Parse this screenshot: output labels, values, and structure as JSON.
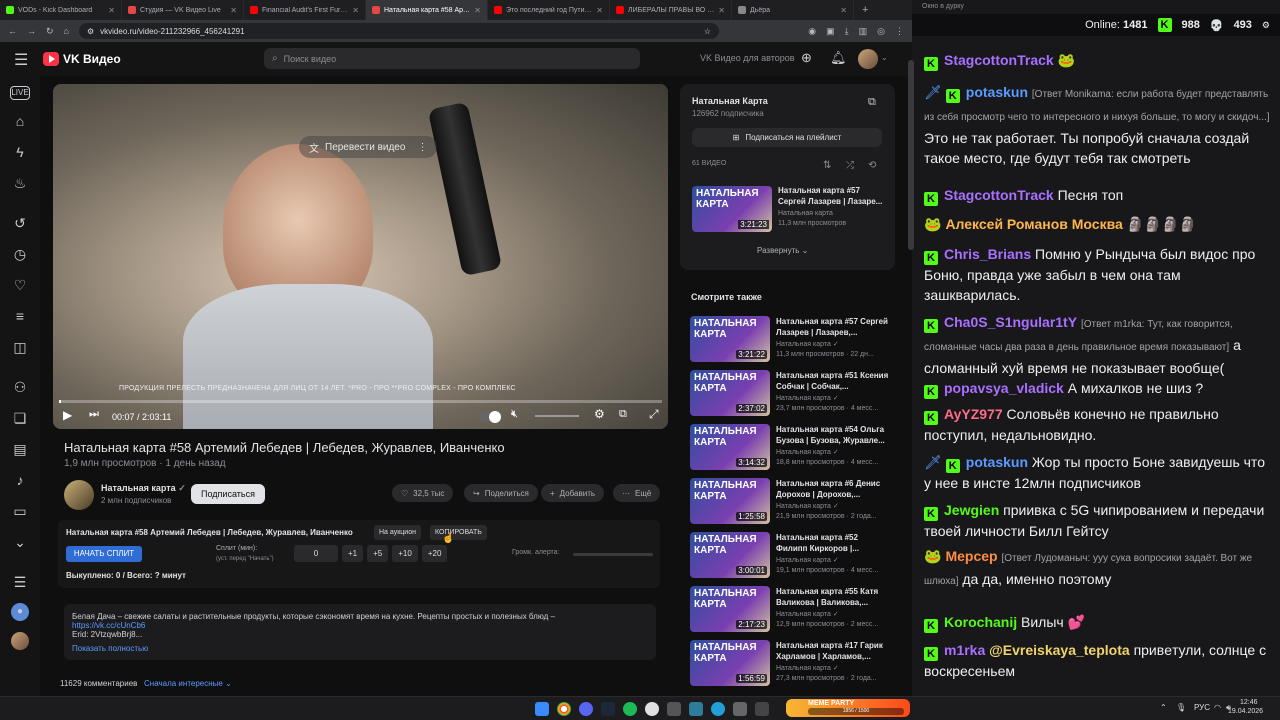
{
  "browser": {
    "tabs": [
      {
        "title": "VODs - Kick Dashboard",
        "color": "#53fc18",
        "active": false
      },
      {
        "title": "Студия — VK Видео Live",
        "color": "#e64646",
        "active": false
      },
      {
        "title": "Financial Audit's First Furry ...",
        "color": "#ff0000",
        "active": false
      },
      {
        "title": "Натальная карта #58 Артем...",
        "color": "#e64646",
        "active": true
      },
      {
        "title": "Это последний год Путина...",
        "color": "#ff0000",
        "active": false
      },
      {
        "title": "ЛИБЕРАЛЫ ПРАВЫ ВО ВСЕМ...",
        "color": "#ff0000",
        "active": false
      },
      {
        "title": "Дьёра",
        "color": "#888888",
        "active": false
      }
    ],
    "url": "vkvideo.ru/video-211232966_456241291"
  },
  "vk": {
    "logo_text": "VK Видео",
    "search_placeholder": "Поиск видео",
    "authors_link": "VK Видео для авторов"
  },
  "player": {
    "translate_label": "Перевести видео",
    "disclaimer": "ПРОДУКЦИЯ ПРЕЛЕСТЬ ПРЕДНАЗНАЧЕНА ДЛЯ ЛИЦ ОТ 14 ЛЕТ. *PRO - ПРО **PRO COMPLEX - ПРО КОМПЛЕКС",
    "time": "00:07 / 2:03:11",
    "progress": 0.001
  },
  "video": {
    "title": "Натальная карта #58 Артемий Лебедев | Лебедев, Журавлев, Иванченко",
    "stats": "1,9 млн просмотров · 1 день назад",
    "channel_name": "Натальная карта",
    "subscribers": "2 млн подписчиков",
    "subscribe": "Подписаться",
    "likes": "32,5 тыс",
    "share": "Поделиться",
    "add": "Добавить",
    "more": "Ещё"
  },
  "split": {
    "title": "Натальная карта #58 Артемий Лебедев | Лебедев, Журавлев, Иванченко",
    "auction_btn": "На аукцион",
    "copy_btn": "КОПИРОВАТЬ",
    "start_btn": "НАЧАТЬ СПЛИТ",
    "split_label": "Сплит (мин):",
    "split_hint": "(уст. перед \"Начать\")",
    "value": "0",
    "inc": [
      "+1",
      "+5",
      "+10",
      "+20"
    ],
    "volume_label": "Громк. алерта:",
    "bought": "Выкуплено: 0 / Всего: ? минут"
  },
  "description": {
    "text": "Белая Дача – свежие салаты и растительные продукты, которые сэкономят время на кухне. Рецепты простых и полезных блюд –",
    "link": "https://vk.cc/cUnCb6",
    "erid": "Erid: 2VtzqwbBrj8...",
    "expand": "Показать полностью"
  },
  "comments": {
    "count": "11629 комментариев",
    "sort": "Сначала интересные"
  },
  "playlist": {
    "name": "Натальная Карта",
    "subs": "126962 подписчика",
    "subscribe": "Подписаться на плейлист",
    "count": "61 ВИДЕО",
    "expand": "Развернуть",
    "item": {
      "title": "Натальная карта #57 Сергей Лазарев | Лазаре...",
      "author": "Натальная карта",
      "meta": "11,3 млн просмотров",
      "duration": "3:21:23",
      "thumb_text": "НАТАЛЬНАЯ КАРТА"
    }
  },
  "also": {
    "heading": "Смотрите также",
    "items": [
      {
        "title": "Натальная карта #57 Сергей Лазарев | Лазарев,...",
        "author": "Натальная карта",
        "meta": "11,3 млн просмотров · 22 дн...",
        "duration": "3:21:22",
        "thumb_text": "НАТАЛЬНАЯ КАРТА"
      },
      {
        "title": "Натальная карта #51 Ксения Собчак | Собчак,...",
        "author": "Натальная карта",
        "meta": "23,7 млн просмотров · 4 месс...",
        "duration": "2:37:02",
        "thumb_text": "НАТАЛЬНАЯ КАРТА"
      },
      {
        "title": "Натальная карта #54 Ольга Бузова | Бузова, Журавле...",
        "author": "Натальная карта",
        "meta": "18,8 млн просмотров · 4 месс...",
        "duration": "3:14:32",
        "thumb_text": "НАТАЛЬНАЯ КАРТА"
      },
      {
        "title": "Натальная карта #6 Денис Дорохов | Дорохов,...",
        "author": "Натальная карта",
        "meta": "21,9 млн просмотров · 2 года...",
        "duration": "1:25:58",
        "thumb_text": "НАТАЛЬНАЯ КАРТА"
      },
      {
        "title": "Натальная карта #52 Филипп Киркоров |...",
        "author": "Натальная карта",
        "meta": "19,1 млн просмотров · 4 месс...",
        "duration": "3:00:01",
        "thumb_text": "НАТАЛЬНАЯ КАРТА"
      },
      {
        "title": "Натальная карта #55 Катя Валикова | Валикова,...",
        "author": "Натальная карта",
        "meta": "12,9 млн просмотров · 2 месс...",
        "duration": "2:17:23",
        "thumb_text": "НАТАЛЬНАЯ КАРТА"
      },
      {
        "title": "Натальная карта #17 Гарик Харламов | Харламов,...",
        "author": "Натальная карта",
        "meta": "27,3 млн просмотров · 2 года...",
        "duration": "1:56:59",
        "thumb_text": "НАТАЛЬНАЯ КАРТА"
      }
    ]
  },
  "chat": {
    "window_title": "Окно в дурку",
    "online_label": "Online:",
    "online": "1481",
    "stat1": "988",
    "stat2": "493",
    "messages": [
      {
        "user": "StagcottonTrack",
        "color": "#a970ff",
        "reply": "",
        "text": "",
        "badges": "k",
        "emote": "🐸"
      },
      {
        "user": "potaskun",
        "color": "#5b9bff",
        "reply": "[Ответ Monikama: если работа будет представлять из себя просмотр чего то интересного и нихуя больше, то могу и скидоч...]",
        "text": "Это не так работает. Ты попробуй сначала создай такое место, где будут тебя так смотреть",
        "badges": "sk",
        "emote": ""
      },
      {
        "user": "StagcottonTrack",
        "color": "#a970ff",
        "reply": "",
        "text": "Песня топ",
        "badges": "k",
        "emote": ""
      },
      {
        "user": "Алексей Романов Москва",
        "color": "#ffb54c",
        "reply": "",
        "text": "",
        "badges": "e",
        "emote": "🗿🗿🗿🗿"
      },
      {
        "user": "Chris_Brians",
        "color": "#a970ff",
        "reply": "",
        "text": "Помню у Рындыча был видос про Боню, правда уже забыл в чем она там зашкварилась.",
        "badges": "k",
        "emote": ""
      },
      {
        "user": "Cha0S_S1ngular1tY",
        "color": "#a970ff",
        "reply": "[Ответ m1rka: Тут, как говорится, сломанные часы два раза в день правильное время показывают]",
        "text": "а сломанный хуй время не показывает вообще(",
        "badges": "k",
        "emote": ""
      },
      {
        "user": "popavsya_vladick",
        "color": "#a970ff",
        "reply": "",
        "text": "А михалков не шиз ?",
        "badges": "k",
        "emote": ""
      },
      {
        "user": "AyYZ977",
        "color": "#ff6b8b",
        "reply": "",
        "text": "Соловьёв конечно не правильно поступил, недальновидно.",
        "badges": "k",
        "emote": ""
      },
      {
        "user": "potaskun",
        "color": "#5b9bff",
        "reply": "",
        "text": "Жор ты просто Боне завидуешь что у нее в инсте 12млн подписчиков",
        "badges": "sk",
        "emote": ""
      },
      {
        "user": "Jewgien",
        "color": "#53fc18",
        "reply": "",
        "text": "приивка с 5G чипированием и передачи твоей личности Билл Гейтсу",
        "badges": "k",
        "emote": ""
      },
      {
        "user": "Мерсер",
        "color": "#ff8c42",
        "reply": "[Ответ Лудоманыч: ууу сука вопросики задаёт. Вот же шлюха]",
        "text": "да да, именно поэтому",
        "badges": "e",
        "emote": ""
      },
      {
        "user": "Korochanij",
        "color": "#53fc18",
        "reply": "",
        "text": "Вилыч",
        "badges": "k",
        "emote": "💕"
      },
      {
        "user": "m1rka",
        "color": "#a970ff",
        "reply": "",
        "text": "привeтули, солнце с воскресеньем",
        "mention": "@Evreiskaya_teplota",
        "badges": "fk",
        "emote": ""
      }
    ]
  },
  "taskbar": {
    "meme_label": "MEME PARTY",
    "meme_sub": "1856 / 1500",
    "lang": "РУС",
    "time": "12:46",
    "date": "19.04.2026"
  }
}
